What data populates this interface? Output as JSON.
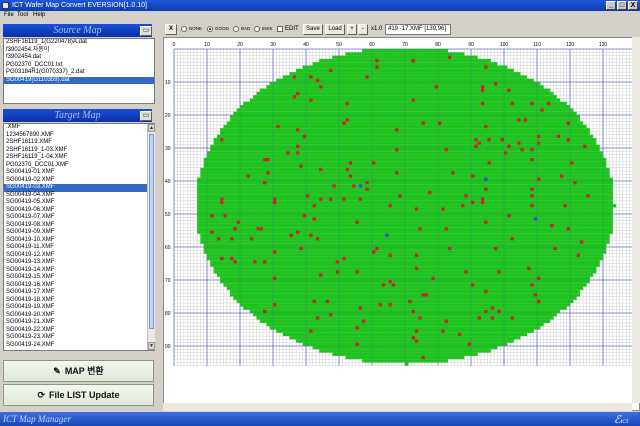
{
  "window": {
    "title": "ICT Wafer Map Convert EVERSION[1.0.10]",
    "buttons": [
      "_",
      "□",
      "X"
    ]
  },
  "menu": [
    "File",
    "Tool",
    "Help"
  ],
  "source_map": {
    "header": "Source Map",
    "items": [
      "2SHF16119_1(G220478)A.dat",
      "f3902454.자동이",
      "f3902454.dat",
      "PG02370_DCC01.txt",
      "PG03184R1(G070337)_2.dat",
      "SG00419(G110359).dat"
    ],
    "selected_index": 5
  },
  "target_map": {
    "header": "Target Map",
    "items": [
      ".XMF",
      "1234567890.XMF",
      "2SHF16119.XMF",
      "2SHF16119_1-03.XMF",
      "2SHF16119_1-04.XMF",
      "PG02370_DCC01.XMF",
      "SG00419-01.XMF",
      "SG00419-02.XMF",
      "SG00419-03.XMF",
      "SG00419-04.XMF",
      "SG00419-05.XMF",
      "SG00419-06.XMF",
      "SG00419-07.XMF",
      "SG00419-08.XMF",
      "SG00419-09.XMF",
      "SG00419-10.XMF",
      "SG00419-11.XMF",
      "SG00419-12.XMF",
      "SG00419-13.XMF",
      "SG00419-14.XMF",
      "SG00419-15.XMF",
      "SG00419-16.XMF",
      "SG00419-17.XMF",
      "SG00419-18.XMF",
      "SG00419-19.XMF",
      "SG00419-20.XMF",
      "SG00419-21.XMF",
      "SG00419-22.XMF",
      "SG00419-23.XMF",
      "SG00419-24.XMF"
    ],
    "selected_index": 8
  },
  "buttons": {
    "map": "MAP 변환",
    "file_list_update": "File LIST Update",
    "header_icon": "folder-icon"
  },
  "toolbar": {
    "x_label": "X",
    "radios": [
      {
        "label": "NONE",
        "selected": false
      },
      {
        "label": "GOOD",
        "selected": true
      },
      {
        "label": "BAD",
        "selected": false
      },
      {
        "label": "INKE",
        "selected": false
      }
    ],
    "edit_label": "EDIT",
    "edit_checked": false,
    "save_label": "Save",
    "load_label": "Load",
    "plus_label": "+",
    "minus_label": "-",
    "zoom": "x1.0",
    "file_info": "419 -17.XMF [139,96]"
  },
  "wafer": {
    "x_ticks": [
      0,
      10,
      20,
      30,
      40,
      50,
      60,
      70,
      80,
      90,
      100,
      110,
      120,
      130
    ],
    "y_ticks": [
      10,
      20,
      30,
      40,
      50,
      60,
      70,
      80,
      90
    ],
    "cols": 139,
    "rows": 96,
    "colors": {
      "good": "#1ec31e",
      "bad": "#c8262a",
      "marker": "#3a4fd0",
      "grid": "#b4b4b4",
      "major_grid": "#404caf"
    },
    "bad_die_count": 208
  },
  "status": {
    "left": "ICT Map Manager",
    "logo": "ICT"
  },
  "icons": {
    "status_logo": "ict-logo-icon",
    "file_list_button": "refresh-icon"
  }
}
